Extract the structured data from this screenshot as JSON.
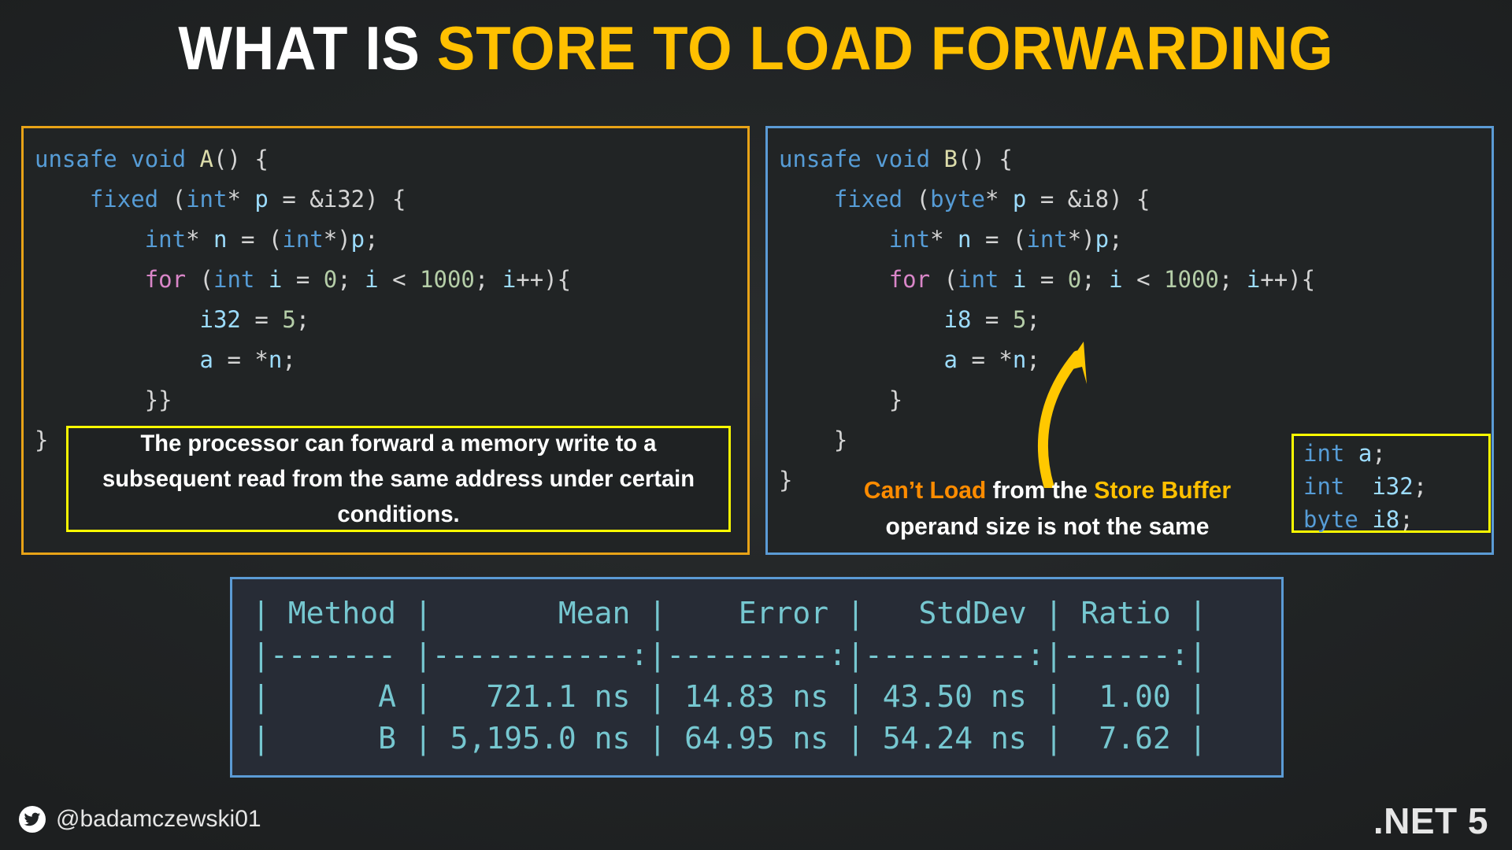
{
  "title": {
    "part_white": "WHAT IS ",
    "part_yellow": "STORE TO LOAD FORWARDING"
  },
  "colors": {
    "background": "#222526",
    "title_white": "#ffffff",
    "title_yellow": "#ffc000",
    "panel_left_border": "#e8a317",
    "panel_right_border": "#5b9bd5",
    "callout_border": "#ffff00",
    "table_border": "#5b9bd5",
    "table_text": "#76c7d0",
    "arrow": "#ffc800",
    "accent_orange": "#ff8c00"
  },
  "panel_left": {
    "name": "Method A",
    "border_color": "#e8a317",
    "code_lines": [
      "unsafe void A() {",
      "    fixed (int* p = &i32) {",
      "        int* n = (int*)p;",
      "        for (int i = 0; i < 1000; i++){",
      "            i32 = 5;",
      "            a = *n;",
      "        }}",
      "}"
    ]
  },
  "panel_right": {
    "name": "Method B",
    "border_color": "#5b9bd5",
    "code_lines": [
      "unsafe void B() {",
      "    fixed (byte* p = &i8) {",
      "        int* n = (int*)p;",
      "        for (int i = 0; i < 1000; i++){",
      "            i8 = 5;",
      "            a = *n;",
      "        }",
      "    }",
      "}"
    ]
  },
  "callout": {
    "text": "The processor can forward a memory write to a subsequent read from the same address under certain conditions."
  },
  "annotation": {
    "line1_orange": "Can’t Load",
    "line1_white": " from the ",
    "line1_amber": "Store Buffer",
    "line2": "operand size is not the same"
  },
  "declarations": {
    "lines": [
      "int a;",
      "int  i32;",
      "byte i8;"
    ]
  },
  "chart_data": {
    "type": "table",
    "title": "BenchmarkDotNet results",
    "columns": [
      "Method",
      "Mean",
      "Error",
      "StdDev",
      "Ratio"
    ],
    "rows": [
      [
        "A",
        "721.1 ns",
        "14.83 ns",
        "43.50 ns",
        "1.00"
      ],
      [
        "B",
        "5,195.0 ns",
        "64.95 ns",
        "54.24 ns",
        "7.62"
      ]
    ],
    "ascii": [
      "| Method |       Mean |    Error |   StdDev | Ratio |",
      "|------- |-----------:|---------:|---------:|------:|",
      "|      A |   721.1 ns | 14.83 ns | 43.50 ns |  1.00 |",
      "|      B | 5,195.0 ns | 64.95 ns | 54.24 ns |  7.62 |"
    ],
    "values": {
      "mean_ns": [
        721.1,
        5195.0
      ],
      "error_ns": [
        14.83,
        64.95
      ],
      "stddev_ns": [
        43.5,
        54.24
      ],
      "ratio": [
        1.0,
        7.62
      ]
    }
  },
  "footer": {
    "handle": "@badamczewski01",
    "icon": "twitter-icon",
    "platform": ".NET 5"
  }
}
